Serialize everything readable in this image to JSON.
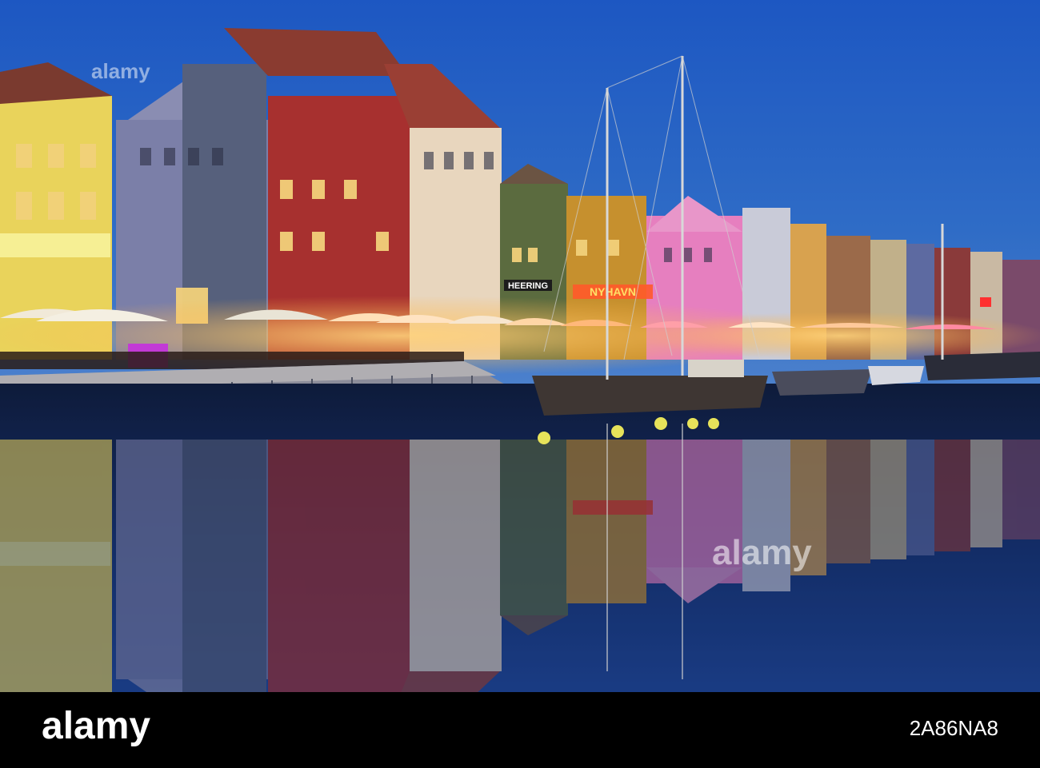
{
  "watermark": {
    "brand": "alamy"
  },
  "footer": {
    "logo_text": "alamy",
    "image_id": "2A86NA8"
  },
  "signs": {
    "heering": "HEERING",
    "nyhavn": "NYHAVN"
  },
  "colors": {
    "sky_top": "#1f5fc8",
    "sky_bottom": "#3a74c9",
    "water_top": "#101d3c",
    "water_bottom": "#1b3f8c",
    "footer_bg": "#000000"
  }
}
